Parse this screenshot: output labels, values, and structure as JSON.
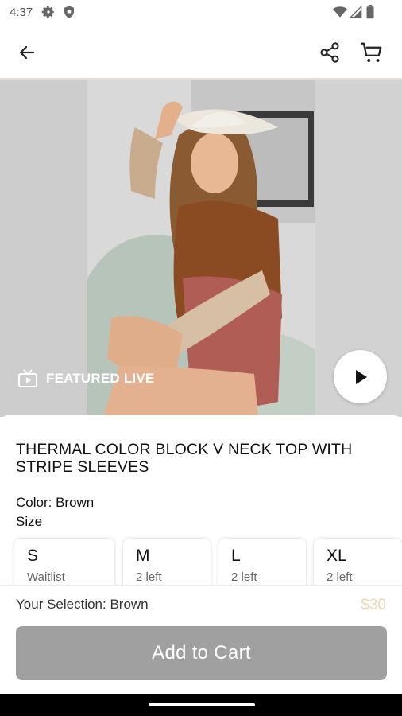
{
  "status_bar": {
    "time": "4:37"
  },
  "media": {
    "featured_label": "FEATURED LIVE"
  },
  "product": {
    "title": "THERMAL COLOR BLOCK V NECK TOP WITH STRIPE SLEEVES",
    "color_label": "Color: Brown",
    "size_label": "Size",
    "sizes": [
      {
        "label": "S",
        "availability": "Waitlist"
      },
      {
        "label": "M",
        "availability": "2 left"
      },
      {
        "label": "L",
        "availability": "2 left"
      },
      {
        "label": "XL",
        "availability": "2 left"
      }
    ],
    "selection": "Your Selection: Brown",
    "price": "$30"
  },
  "actions": {
    "add_to_cart": "Add to Cart"
  },
  "colors": {
    "accent_price": "#ecd6b6",
    "button_disabled": "#a0a0a0"
  },
  "icons": [
    "settings-icon",
    "shield-icon",
    "wifi-icon",
    "signal-icon",
    "battery-icon",
    "back-arrow-icon",
    "share-icon",
    "cart-icon",
    "live-tv-icon",
    "play-icon"
  ]
}
